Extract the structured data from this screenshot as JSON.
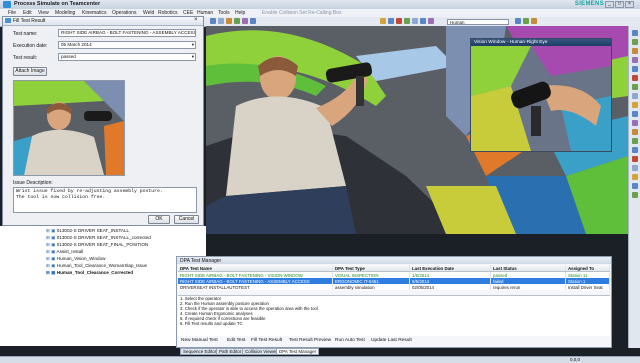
{
  "app": {
    "title": "Process Simulate on Teamcenter",
    "brand": "SIEMENS",
    "window_buttons": [
      "_",
      "□",
      "×"
    ]
  },
  "menu": [
    "File",
    "Edit",
    "View",
    "Modeling",
    "Kinematics",
    "Operations",
    "Weld",
    "Robotics",
    "CEE",
    "Human",
    "Tools",
    "Help"
  ],
  "toolbar": {
    "hint": "Enable Collision Set Re-Calling Box",
    "combo_value": "Human"
  },
  "dialog": {
    "title": "Fill Test Result",
    "test_name_label": "Test name:",
    "test_name_value": "RIGHT SIDE AIRBAG - BOLT FASTENING - ASSEMBLY ACCESS",
    "execution_date_label": "Execution date:",
    "execution_date_value": "05    March    2014",
    "test_result_label": "Test result:",
    "test_result_value": "passed",
    "attach_image_label": "Attach Image",
    "issue_description_label": "Issue Description:",
    "issue_description_line1": "Wrist issue fixed by re-adjusting assembly posture.",
    "issue_description_line2": "The tool is now collision free.",
    "ok_label": "OK",
    "cancel_label": "Cancel"
  },
  "inset": {
    "title": "Vision Window - Human-Right Eye"
  },
  "tree": [
    "013002-S DRIVER SEAT_INSTALL",
    "013002-S DRIVER SEAT_INSTALL_corrected",
    "013002-S DRIVER SEAT_FINAL_POSITION",
    "Assist_Install",
    "Human_Vision_Window",
    "Human_Tool_Clearance_WomanSlap_Issue",
    "Human_Tool_Clearance_Corrected"
  ],
  "test_manager": {
    "title": "DPA Test Manager",
    "columns": [
      "DPA Test Name",
      "DPA Test Type",
      "Last Execution Date",
      "Last Status",
      "Assigned To"
    ],
    "rows": [
      [
        "RIGHT SIDE AIRBAG - BOLT FASTENING - VISION WINDOW",
        "VISUAL INSPECTION",
        "1/5/2014",
        "passed",
        "Station 11"
      ],
      [
        "RIGHT SIDE AIRBAG - BOLT FASTENING - ASSEMBLY ACCESS",
        "ERGONOMIC IT-0451",
        "5/5/2014",
        "failed",
        "Station 1"
      ],
      [
        "DRIVERSEAT INSTALLAUTOTEST",
        "assembly simulation",
        "02/05/2014",
        "requires rerun",
        "Install Driver Seat"
      ]
    ],
    "steps": [
      "1. Select the operator",
      "2. Run the Human assembly posture operation",
      "3. Check if the operator is able to access the operation area with the tool",
      "4. Create Human Ergonomic analyses",
      "5. If required check if corrections are feasible",
      "6. Fill Test results and update TC"
    ],
    "buttons": [
      "New Manual Test",
      "Edit Test",
      "Fill Test Result",
      "Test Result Preview",
      "Run Auto Test",
      "Update Last Result"
    ]
  },
  "tabs": [
    "Sequence Editor",
    "Path Editor",
    "Collision Viewer",
    "DPA Test Manager"
  ],
  "status": {
    "coords": "0,0,0"
  },
  "colors": {
    "selection": "#2f7de0",
    "passed_text": "#1d8a1d",
    "brand": "#1aa0a0"
  }
}
